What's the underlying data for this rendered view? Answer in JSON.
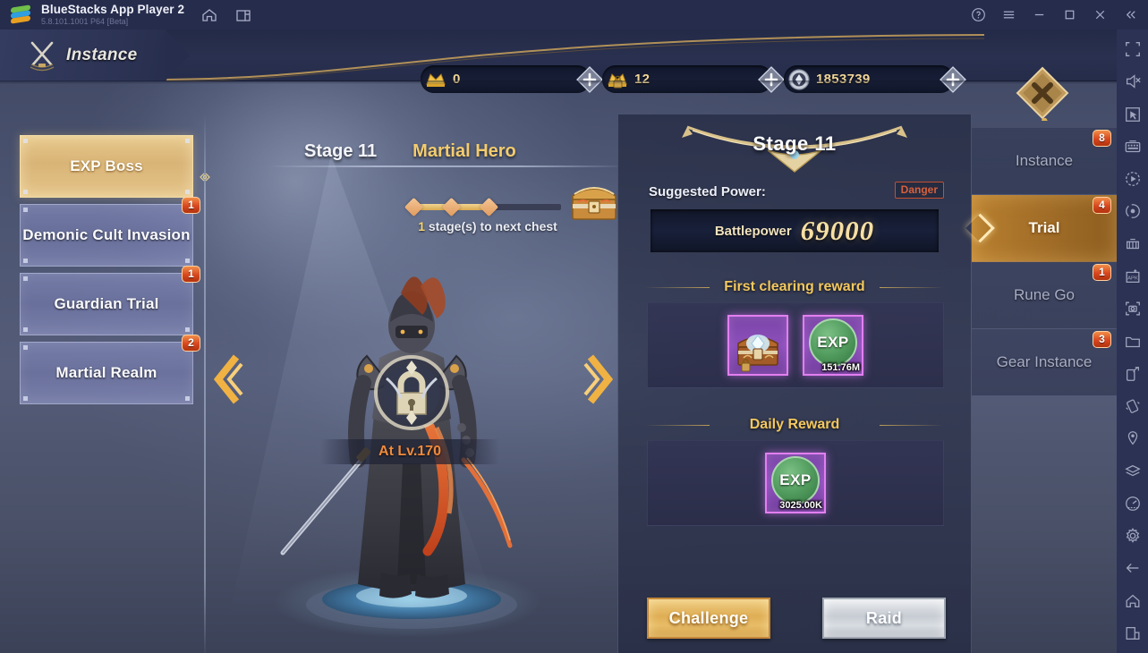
{
  "titlebar": {
    "app_name": "BlueStacks App Player 2",
    "version": "5.8.101.1001 P64 [Beta]",
    "icons": [
      "home-icon",
      "multi-instance-icon"
    ],
    "window_controls": [
      "help-icon",
      "menu-icon",
      "minimize-icon",
      "maximize-icon",
      "close-icon",
      "collapse-icon"
    ]
  },
  "game": {
    "header": {
      "tab_label": "Instance",
      "currencies": [
        {
          "name": "gold-ingot",
          "value": "0"
        },
        {
          "name": "locked-gold-ingot",
          "value": "12"
        },
        {
          "name": "silver-coin",
          "value": "1853739"
        }
      ],
      "add_button": "plus-icon"
    },
    "left_menu": [
      {
        "label": "EXP Boss",
        "badge": "",
        "active": true
      },
      {
        "label": "Demonic Cult Invasion",
        "badge": "1",
        "active": false
      },
      {
        "label": "Guardian Trial",
        "badge": "1",
        "active": false
      },
      {
        "label": "Martial Realm",
        "badge": "2",
        "active": false
      }
    ],
    "stage": {
      "number": "Stage 11",
      "name": "Martial Hero",
      "chest_note_count": "1",
      "chest_note_text": "stage(s) to next chest",
      "progress_nodes": 3,
      "progress_filled": 2
    },
    "hero": {
      "level_text": "At Lv.170",
      "lock_icon": "lock-icon",
      "prev_arrow": "chevron-left-icon",
      "next_arrow": "chevron-right-icon"
    },
    "info_panel": {
      "stage_title": "Stage 11",
      "suggested_power_label": "Suggested Power:",
      "danger_badge": "Danger",
      "battlepower_label": "Battlepower",
      "battlepower_value": "69000",
      "first_clearing_title": "First clearing reward",
      "first_clearing_items": [
        {
          "name": "treasure-chest-item",
          "qty": ""
        },
        {
          "name": "exp-orb-item",
          "label": "EXP",
          "qty": "151.76M"
        }
      ],
      "daily_reward_title": "Daily Reward",
      "daily_reward_items": [
        {
          "name": "exp-orb-item",
          "label": "EXP",
          "qty": "3025.00K"
        }
      ],
      "challenge_button": "Challenge",
      "raid_button": "Raid"
    },
    "right_nav": [
      {
        "label": "Instance",
        "badge": "8",
        "active": false
      },
      {
        "label": "Trial",
        "badge": "4",
        "active": true
      },
      {
        "label": "Rune Go",
        "badge": "1",
        "active": false
      },
      {
        "label": "Gear Instance",
        "badge": "3",
        "active": false
      }
    ],
    "close_button": "close-diamond-icon"
  },
  "bluestacks_sidebar": {
    "icons": [
      "fullscreen-icon",
      "mute-icon",
      "cursor-icon",
      "keyboard-icon",
      "macro-play-icon",
      "record-icon",
      "multi-instance-manager-icon",
      "install-apk-icon",
      "screenshot-icon",
      "media-folder-icon",
      "rotate-icon",
      "shake-icon",
      "location-icon",
      "layers-icon",
      "performance-icon",
      "settings-icon",
      "back-icon",
      "home-icon",
      "recents-icon"
    ]
  },
  "colors": {
    "accent_gold": "#f3cc6e",
    "danger": "#c4502f",
    "badge_red": "#d8471f",
    "exp_green": "#55a062",
    "item_purple": "#8c4fbb",
    "panel_bg": "#2c324a"
  }
}
